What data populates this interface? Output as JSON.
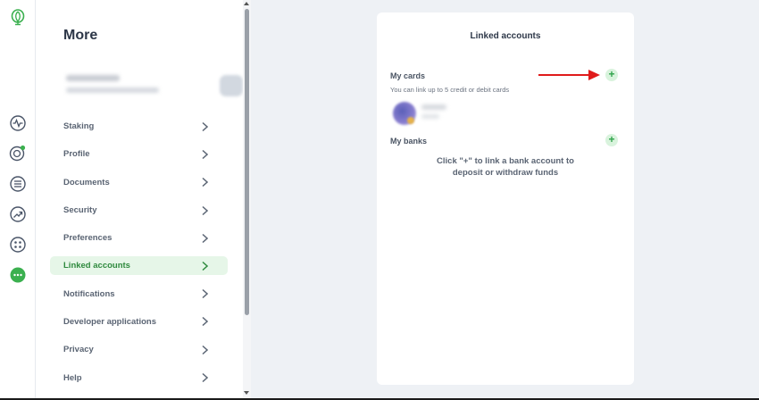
{
  "rail": {
    "icons": [
      "logo-icon",
      "activity-icon",
      "rewards-icon",
      "list-icon",
      "trending-icon",
      "apps-icon",
      "more-icon"
    ]
  },
  "menu": {
    "title": "More",
    "items": [
      {
        "label": "Staking"
      },
      {
        "label": "Profile"
      },
      {
        "label": "Documents"
      },
      {
        "label": "Security"
      },
      {
        "label": "Preferences"
      },
      {
        "label": "Linked accounts",
        "active": true
      },
      {
        "label": "Notifications"
      },
      {
        "label": "Developer applications"
      },
      {
        "label": "Privacy"
      },
      {
        "label": "Help"
      }
    ]
  },
  "panel": {
    "title": "Linked accounts",
    "cards_label": "My cards",
    "cards_sub": "You can link up to 5 credit or debit cards",
    "banks_label": "My banks",
    "banks_msg_line1": "Click \"+\" to link a bank account to",
    "banks_msg_line2": "deposit or withdraw funds",
    "add_symbol": "+"
  },
  "colors": {
    "accent": "#2fa34a",
    "active_bg": "#e6f6e8",
    "arrow": "#e01b1b"
  }
}
